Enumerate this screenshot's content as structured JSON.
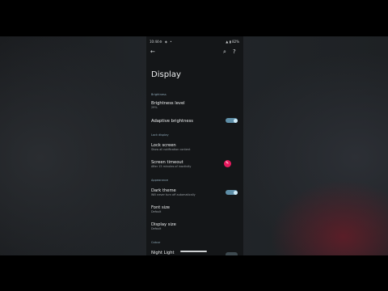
{
  "status_bar": {
    "time": "10:44",
    "left_icons": [
      "gear-icon",
      "wifi-icon",
      "notification-icon"
    ],
    "battery": "82%"
  },
  "appbar": {
    "back_icon": "arrow-back-icon",
    "search_icon": "search-icon",
    "help_icon": "help-icon"
  },
  "page": {
    "title": "Display"
  },
  "sections": {
    "brightness": "Brightness",
    "lock_display": "Lock display",
    "appearance": "Appearance",
    "colour": "Colour"
  },
  "items": {
    "brightness_level": {
      "label": "Brightness level",
      "sub": "29%"
    },
    "adaptive_brightness": {
      "label": "Adaptive brightness",
      "on": true
    },
    "lock_screen": {
      "label": "Lock screen",
      "sub": "Show all notification content"
    },
    "screen_timeout": {
      "label": "Screen timeout",
      "sub": "After 15 minutes of inactivity"
    },
    "dark_theme": {
      "label": "Dark theme",
      "sub": "Will never turn off automatically",
      "on": true
    },
    "font_size": {
      "label": "Font size",
      "sub": "Default"
    },
    "display_size": {
      "label": "Display size",
      "sub": "Default"
    },
    "night_light": {
      "label": "Night Light"
    }
  },
  "colors": {
    "toggle_track": "#5f8fa8",
    "accent_dot": "#e8195e",
    "section_header": "#8fa9b8"
  }
}
